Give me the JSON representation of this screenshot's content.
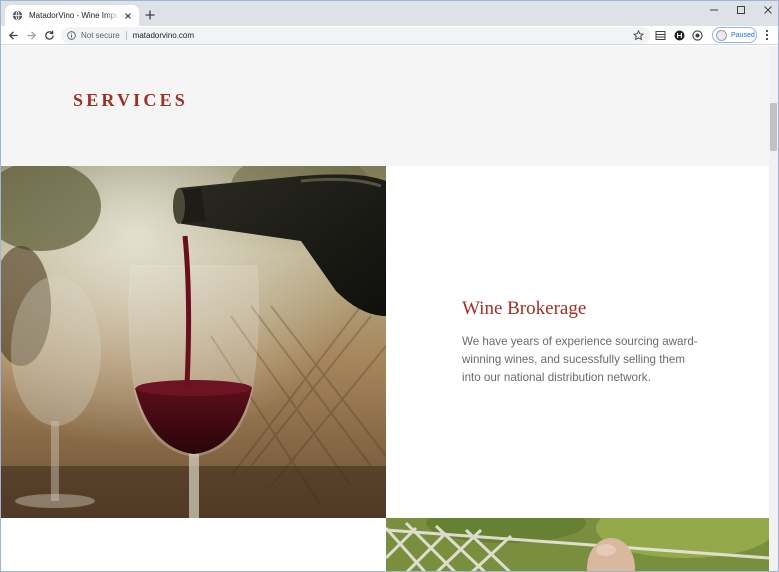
{
  "browser": {
    "tab_title": "MatadorVino - Wine Importer and Distributor",
    "security_label": "Not secure",
    "url": "matadorvino.com",
    "profile_status": "Paused",
    "accent": "#1a73e8"
  },
  "page": {
    "section_title": "SERVICES",
    "service": {
      "title": "Wine Brokerage",
      "description": "We have years of experience sourcing award-winning wines, and sucessfully selling them into our national distribution network."
    },
    "colors": {
      "brand_red": "#a02f25",
      "band_gray": "#f5f5f5",
      "body_text": "#6b6b6b"
    }
  },
  "icons": {
    "favicon": "globe-icon",
    "tab_close": "close-icon",
    "new_tab": "plus-icon",
    "back": "arrow-left-icon",
    "forward": "arrow-right-icon",
    "reload": "reload-icon",
    "site_info": "info-icon",
    "bookmark": "star-icon",
    "menu": "kebab-menu-icon"
  }
}
